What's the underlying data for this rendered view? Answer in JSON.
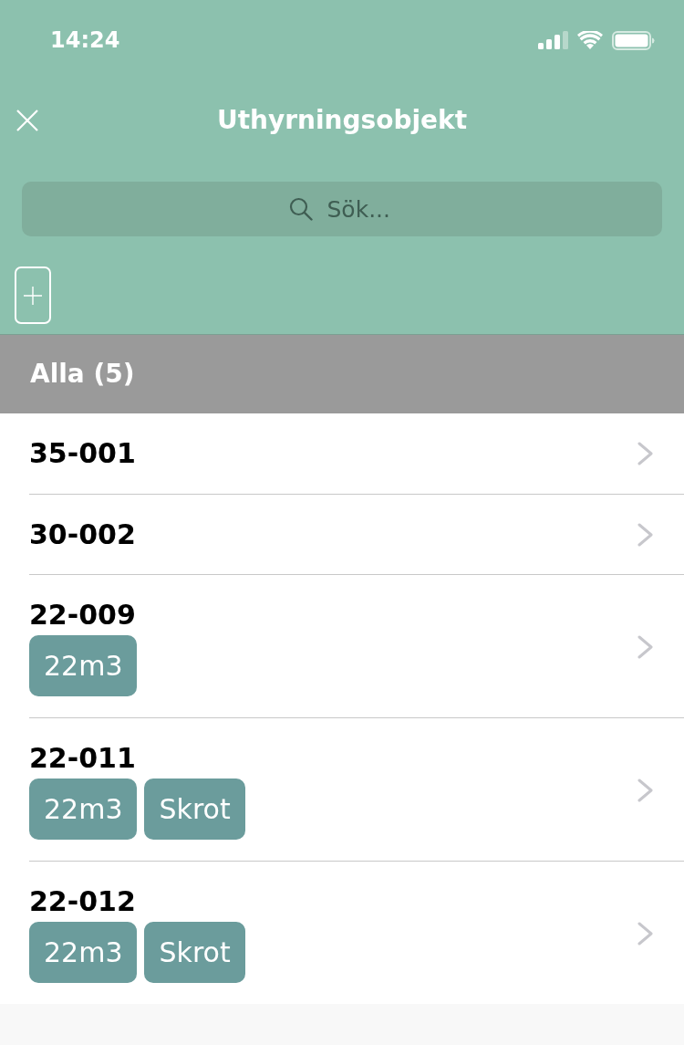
{
  "status_bar": {
    "time": "14:24"
  },
  "nav": {
    "title": "Uthyrningsobjekt"
  },
  "search": {
    "placeholder": "Sök..."
  },
  "section": {
    "title": "Alla (5)"
  },
  "items": [
    {
      "title": "35-001"
    },
    {
      "title": "30-002"
    },
    {
      "title": "22-009",
      "tags": [
        "22m3"
      ]
    },
    {
      "title": "22-011",
      "tags": [
        "22m3",
        "Skrot"
      ]
    },
    {
      "title": "22-012",
      "tags": [
        "22m3",
        "Skrot"
      ]
    }
  ]
}
